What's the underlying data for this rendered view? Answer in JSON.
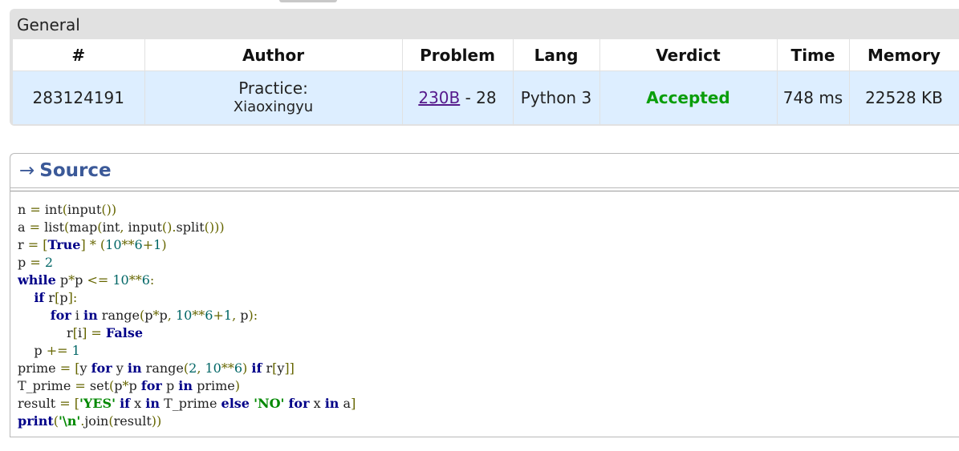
{
  "general": {
    "title": "General",
    "columns": [
      "#",
      "Author",
      "Problem",
      "Lang",
      "Verdict",
      "Time",
      "Memory"
    ],
    "submission": {
      "id": "283124191",
      "author_prefix": "Practice:",
      "author_name": "Xiaoxingyu",
      "problem_link": "230B",
      "problem_suffix": "- 28",
      "lang": "Python 3",
      "verdict": "Accepted",
      "time": "748 ms",
      "memory": "22528 KB"
    }
  },
  "source": {
    "arrow": "→",
    "title": "Source",
    "code_lines": [
      "n = int(input())",
      "a = list(map(int, input().split()))",
      "r = [True] * (10**6+1)",
      "p = 2",
      "while p*p <= 10**6:",
      "    if r[p]:",
      "        for i in range(p*p, 10**6+1, p):",
      "            r[i] = False",
      "    p += 1",
      "prime = [y for y in range(2, 10**6) if r[y]]",
      "T_prime = set(p*p for p in prime)",
      "result = ['YES' if x in T_prime else 'NO' for x in a]",
      "print('\\n'.join(result))"
    ]
  },
  "colors": {
    "accepted": "#0a9e0a",
    "source_title": "#3b5998",
    "row_highlight": "#ddeeff",
    "link": "#551a8b"
  }
}
